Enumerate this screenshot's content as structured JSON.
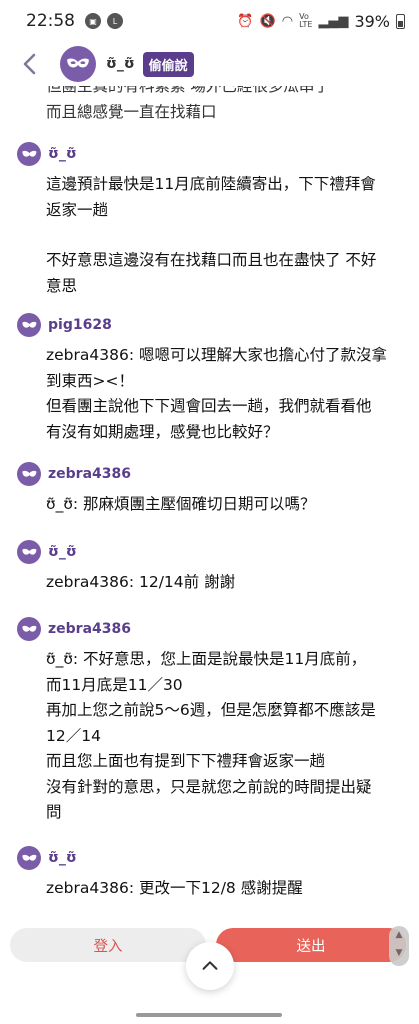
{
  "status_bar": {
    "time": "22:58",
    "battery": "39%",
    "icons": [
      "photo-icon",
      "line-app-icon",
      "alarm-icon",
      "mute-icon",
      "wifi-icon",
      "volte-icon",
      "signal-icon",
      "battery-icon"
    ]
  },
  "header": {
    "name": "ʊ̃_ʊ̃",
    "badge": "偷偷說"
  },
  "messages": [
    {
      "user": "",
      "lines": [
        "但團主真的有科素素 場外已經很多瓜串了",
        "而且總感覺一直在找藉口"
      ]
    },
    {
      "user": "ʊ̃_ʊ̃",
      "lines": [
        "這邊預計最快是11月底前陸續寄出，下下禮拜會",
        "返家一趟",
        "",
        "不好意思這邊沒有在找藉口而且也在盡快了 不好",
        "意思"
      ]
    },
    {
      "user": "pig1628",
      "lines": [
        "zebra4386: 嗯嗯可以理解大家也擔心付了款沒拿",
        "到東西><！",
        "但看團主說他下下週會回去一趟，我們就看看他",
        "有沒有如期處理，感覺也比較好？"
      ]
    },
    {
      "user": "zebra4386",
      "lines": [
        "ʊ̃_ʊ̃: 那麻煩團主壓個確切日期可以嗎？"
      ]
    },
    {
      "user": "ʊ̃_ʊ̃",
      "lines": [
        "zebra4386: 12/14前 謝謝"
      ]
    },
    {
      "user": "zebra4386",
      "lines": [
        "ʊ̃_ʊ̃: 不好意思，您上面是說最快是11月底前，",
        "而11月底是11／30",
        "再加上您之前說5～6週，但是怎麼算都不應該是",
        "12／14",
        "而且您上面也有提到下下禮拜會返家一趟",
        "沒有針對的意思，只是就您之前說的時間提出疑",
        "問"
      ]
    },
    {
      "user": "ʊ̃_ʊ̃",
      "lines": [
        "zebra4386: 更改一下12/8 感謝提醒"
      ]
    }
  ],
  "bottom_bar": {
    "login_label": "登入",
    "send_label": "送出"
  },
  "colors": {
    "accent_purple": "#5a3e8c",
    "avatar_purple": "#7b5ca8",
    "send_red": "#e8645a",
    "login_text": "#d9534f"
  }
}
